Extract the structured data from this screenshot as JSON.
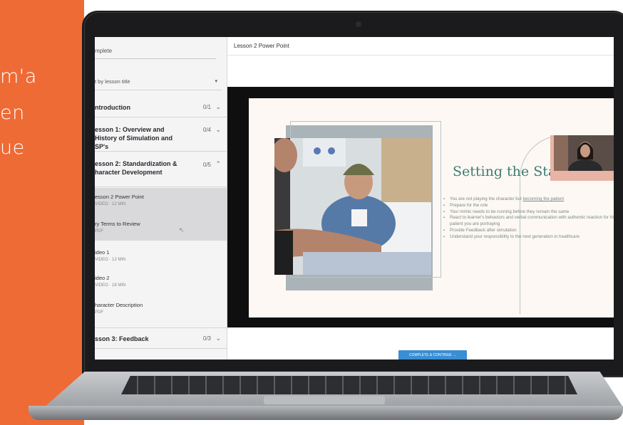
{
  "promo": {
    "lines": [
      "m'a",
      "en",
      "ue"
    ],
    "color": "#ee6b36"
  },
  "sidebar": {
    "search_text": "mplete",
    "sort_label": "t by lesson title",
    "modules": [
      {
        "title": "ntroduction",
        "count": "0/1",
        "chevron": "chevron-down"
      },
      {
        "title": "esson 1: Overview and History of Simulation and SP's",
        "count": "0/4",
        "chevron": "chevron-down"
      },
      {
        "title": "esson 2: Standardization & haracter Development",
        "count": "0/5",
        "chevron": "chevron-up"
      },
      {
        "title": "sson 3: Feedback",
        "count": "0/3",
        "chevron": "chevron-down"
      }
    ],
    "lessons": [
      {
        "title": "esson 2 Power Point",
        "meta": "VIDEO · 12 MIN"
      },
      {
        "title": "ry Terms to Review",
        "meta": "PDF"
      },
      {
        "title": "ideo 1",
        "meta": "VIDEO · 12 MIN"
      },
      {
        "title": "ideo 2",
        "meta": "VIDEO · 18 MIN"
      },
      {
        "title": "haracter Description",
        "meta": "PDF"
      }
    ]
  },
  "main": {
    "lesson_title": "Lesson 2 Power Point",
    "complete_button": "COMPLETE & CONTINUE →"
  },
  "slide": {
    "title": "Setting the Stage",
    "bullets": [
      {
        "text": "You are not playing the character but",
        "link": "becoming the patient"
      },
      {
        "text": "Prepare for the role"
      },
      {
        "text": "Your mimic needs to be running before they remain the same"
      },
      {
        "text": "React to learner's behaviors and verbal communication with authentic reaction for the patient you are portraying"
      },
      {
        "text": "Provide Feedback after simulation"
      },
      {
        "text": "Understand your responsibility to the next generation in healthcare"
      }
    ],
    "title_color": "#3e7d72"
  }
}
